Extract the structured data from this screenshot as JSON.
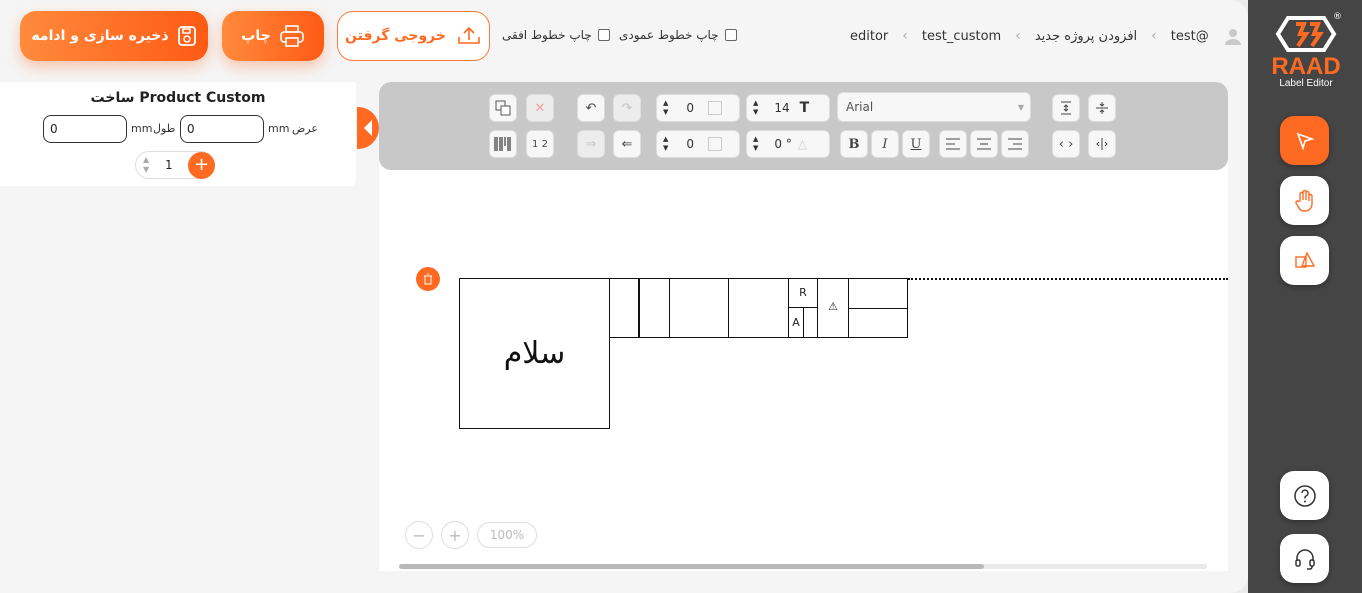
{
  "header": {
    "save_label": "ذخیره سازی و ادامه",
    "print_label": "چاپ",
    "export_label": "خروجی گرفتن",
    "print_horizontal_label": "چاپ خطوط افقی",
    "print_vertical_label": "چاپ خطوط عمودی",
    "print_horizontal_checked": false,
    "print_vertical_checked": false
  },
  "breadcrumb": {
    "items": [
      "editor",
      "test_custom",
      "افزودن پروژه جدید"
    ],
    "user": "test@"
  },
  "left_panel": {
    "title": "ساخت Product Custom",
    "width_label": "عرض",
    "width_unit": "mm",
    "width_value": "0",
    "length_label": "طول",
    "length_unit": "mm",
    "length_value": "0",
    "quantity": "1"
  },
  "toolbar": {
    "font_name": "Arial",
    "font_size": "14",
    "line_spacing": "0",
    "letter_spacing": "0",
    "rotation": "0 °",
    "bold": "B",
    "italic": "I",
    "underline": "U"
  },
  "canvas": {
    "label_text": "سلام",
    "cell_r": "R",
    "cell_a": "A",
    "cell_warn": "⚠",
    "zoom_level": "100%"
  },
  "brand": {
    "name": "RAAD",
    "subtitle": "Label Editor",
    "registered": "®"
  },
  "colors": {
    "accent": "#ff6a22",
    "sidebar": "#454545",
    "toolbar": "#c8c8c8"
  }
}
